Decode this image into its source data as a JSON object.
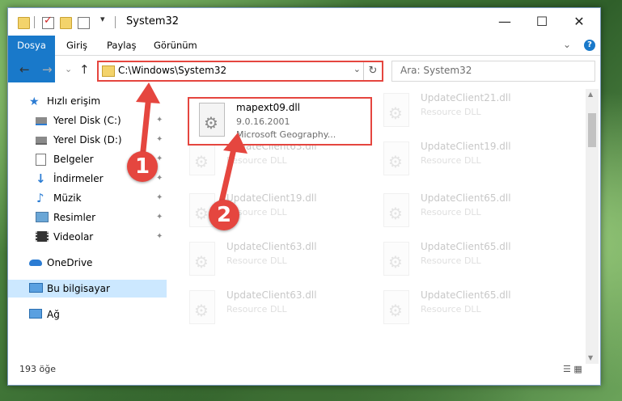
{
  "window": {
    "title": "System32",
    "controls": {
      "minimize": "—",
      "maximize": "☐",
      "close": "✕"
    }
  },
  "ribbon": {
    "tabs": [
      "Dosya",
      "Giriş",
      "Paylaş",
      "Görünüm"
    ],
    "expand_icon": "chevron-down-icon",
    "help_label": "?"
  },
  "nav": {
    "back": "←",
    "forward": "→",
    "recent": "⌄",
    "up": "↑"
  },
  "address": {
    "path": "C:\\Windows\\System32",
    "dropdown": "⌄",
    "refresh": "↻"
  },
  "search": {
    "placeholder": "Ara: System32"
  },
  "sidebar": {
    "items": [
      {
        "label": "Hızlı erişim",
        "icon": "star-icon",
        "pinned": false
      },
      {
        "label": "Yerel Disk (C:)",
        "icon": "drive-icon",
        "pinned": true
      },
      {
        "label": "Yerel Disk (D:)",
        "icon": "drive-icon",
        "pinned": true
      },
      {
        "label": "Belgeler",
        "icon": "documents-icon",
        "pinned": true
      },
      {
        "label": "İndirmeler",
        "icon": "download-icon",
        "pinned": true
      },
      {
        "label": "Müzik",
        "icon": "music-icon",
        "pinned": true
      },
      {
        "label": "Resimler",
        "icon": "pictures-icon",
        "pinned": true
      },
      {
        "label": "Videolar",
        "icon": "videos-icon",
        "pinned": true
      },
      {
        "label": "OneDrive",
        "icon": "cloud-icon",
        "pinned": false
      },
      {
        "label": "Bu bilgisayar",
        "icon": "computer-icon",
        "pinned": false,
        "selected": true
      },
      {
        "label": "Ağ",
        "icon": "network-icon",
        "pinned": false
      }
    ],
    "pin_glyph": "📌"
  },
  "files": {
    "highlighted": {
      "name": "mapext09.dll",
      "version": "9.0.16.2001",
      "description": "Microsoft Geography..."
    },
    "ghost": [
      {
        "name": "UpdateClient21.dll",
        "type": "Resource DLL"
      },
      {
        "name": "UpdateClient63.dll",
        "type": "Resource DLL"
      },
      {
        "name": "UpdateClient19.dll",
        "type": "Resource DLL"
      },
      {
        "name": "UpdateClient19.dll",
        "type": "Resource DLL"
      },
      {
        "name": "UpdateClient65.dll",
        "type": "Resource DLL"
      },
      {
        "name": "UpdateClient63.dll",
        "type": "Resource DLL"
      },
      {
        "name": "UpdateClient65.dll",
        "type": "Resource DLL"
      },
      {
        "name": "UpdateClient63.dll",
        "type": "Resource DLL"
      },
      {
        "name": "UpdateClient65.dll",
        "type": "Resource DLL"
      }
    ]
  },
  "status": {
    "count": "193 öğe"
  },
  "annotations": {
    "step1": "1",
    "step2": "2",
    "accent": "#e5463f"
  }
}
